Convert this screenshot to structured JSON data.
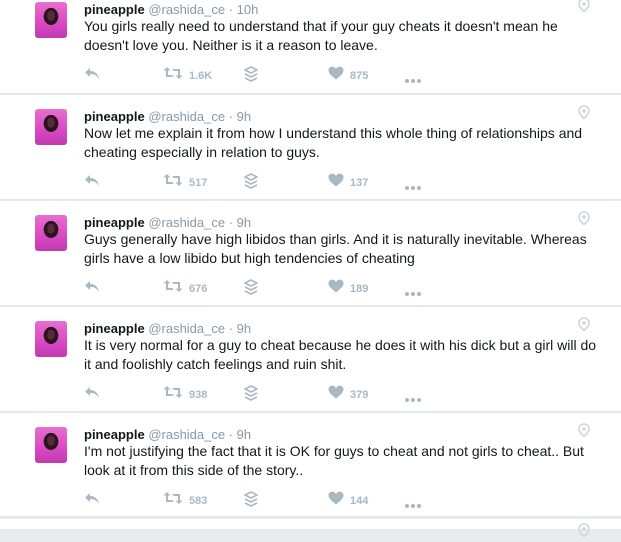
{
  "tweets": [
    {
      "name": "pineapple",
      "handle": "@rashida_ce",
      "time": "10h",
      "text": "You girls really need to understand that if your guy cheats it doesn't mean he doesn't love you.  Neither is it a reason to leave.",
      "retweets": "1.6K",
      "likes": "875"
    },
    {
      "name": "pineapple",
      "handle": "@rashida_ce",
      "time": "9h",
      "text": "Now let me explain it from how I understand this whole thing of relationships and cheating especially in relation to guys.",
      "retweets": "517",
      "likes": "137"
    },
    {
      "name": "pineapple",
      "handle": "@rashida_ce",
      "time": "9h",
      "text": "Guys generally have high libidos than girls. And it is naturally inevitable. Whereas girls have a low libido but high tendencies of cheating",
      "retweets": "676",
      "likes": "189"
    },
    {
      "name": "pineapple",
      "handle": "@rashida_ce",
      "time": "9h",
      "text": "It is very normal for a guy to cheat because he does it with his dick but a girl will do it and foolishly catch feelings and ruin shit.",
      "retweets": "938",
      "likes": "379"
    },
    {
      "name": "pineapple",
      "handle": "@rashida_ce",
      "time": "9h",
      "text": "I'm not justifying the fact that it is OK for guys to cheat and not girls to cheat.. But look at it from this side of the story..",
      "retweets": "583",
      "likes": "144"
    }
  ],
  "colors": {
    "background": "#e6ecf0",
    "card": "#ffffff",
    "text": "#14171a",
    "muted": "#8899a6",
    "icon": "#aab8c2",
    "avatar": "#d848c2"
  },
  "icons": [
    "reply-icon",
    "retweet-icon",
    "stack-icon",
    "heart-icon",
    "more-icon",
    "location-pin-icon"
  ]
}
